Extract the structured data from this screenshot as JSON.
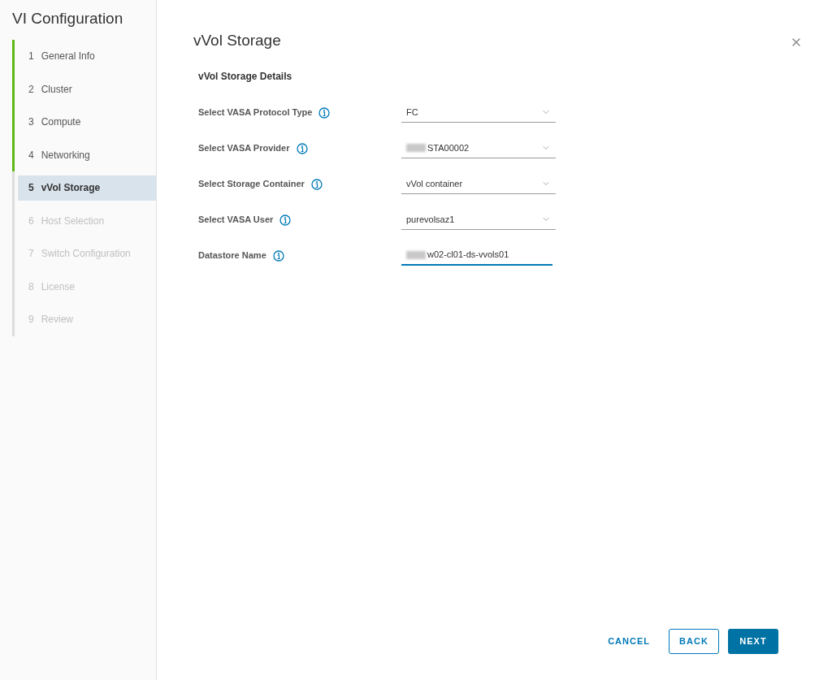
{
  "sidebar": {
    "title": "VI Configuration",
    "steps": [
      {
        "number": "1",
        "label": "General Info",
        "completed": true,
        "selected": false,
        "disabled": false
      },
      {
        "number": "2",
        "label": "Cluster",
        "completed": true,
        "selected": false,
        "disabled": false
      },
      {
        "number": "3",
        "label": "Compute",
        "completed": true,
        "selected": false,
        "disabled": false
      },
      {
        "number": "4",
        "label": "Networking",
        "completed": true,
        "selected": false,
        "disabled": false
      },
      {
        "number": "5",
        "label": "vVol Storage",
        "completed": false,
        "selected": true,
        "disabled": false
      },
      {
        "number": "6",
        "label": "Host Selection",
        "completed": false,
        "selected": false,
        "disabled": true
      },
      {
        "number": "7",
        "label": "Switch Configuration",
        "completed": false,
        "selected": false,
        "disabled": true
      },
      {
        "number": "8",
        "label": "License",
        "completed": false,
        "selected": false,
        "disabled": true
      },
      {
        "number": "9",
        "label": "Review",
        "completed": false,
        "selected": false,
        "disabled": true
      }
    ]
  },
  "main": {
    "title": "vVol Storage",
    "section": "vVol Storage Details",
    "fields": [
      {
        "kind": "dropdown",
        "label": "Select VASA Protocol Type",
        "value": "FC",
        "redacted": false,
        "focused": false
      },
      {
        "kind": "dropdown",
        "label": "Select VASA Provider",
        "value": "STA00002",
        "redacted": true,
        "focused": false
      },
      {
        "kind": "dropdown",
        "label": "Select Storage Container",
        "value": "vVol container",
        "redacted": false,
        "focused": false
      },
      {
        "kind": "dropdown",
        "label": "Select VASA User",
        "value": "purevolsaz1",
        "redacted": false,
        "focused": false
      },
      {
        "kind": "text",
        "label": "Datastore Name",
        "value": "w02-cl01-ds-vvols01",
        "redacted": true,
        "focused": true
      }
    ]
  },
  "buttons": [
    {
      "kind": "flat",
      "label": "CANCEL"
    },
    {
      "kind": "outline",
      "label": "BACK"
    },
    {
      "kind": "primary",
      "label": "NEXT"
    }
  ]
}
